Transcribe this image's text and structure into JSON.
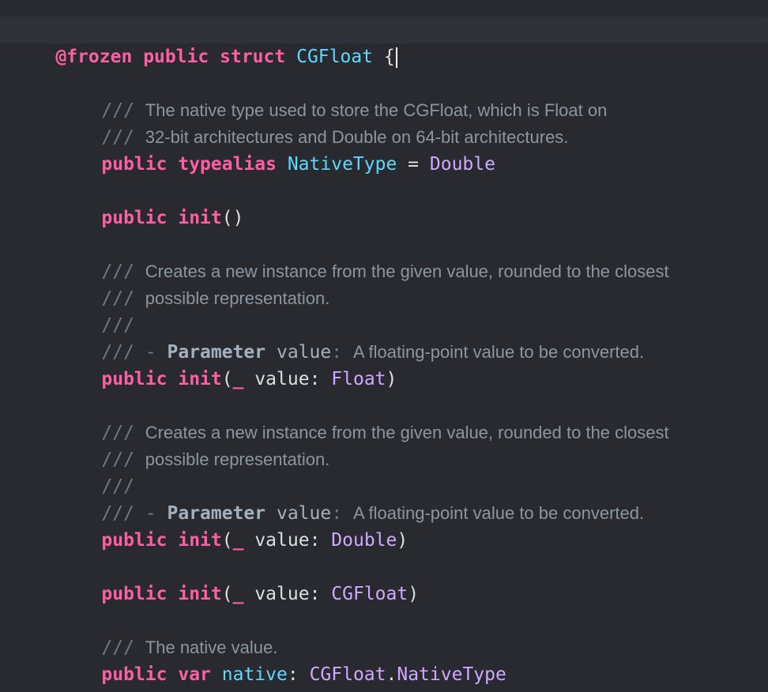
{
  "code": {
    "line1": {
      "attr": "@frozen",
      "kw1": "public",
      "kw2": "struct",
      "name": "CGFloat",
      "brace": "{"
    },
    "doc1a": {
      "slashes": "///",
      "text": "The native type used to store the CGFloat, which is Float on"
    },
    "doc1b": {
      "slashes": "///",
      "text": "32-bit architectures and Double on 64-bit architectures."
    },
    "typealias": {
      "kw1": "public",
      "kw2": "typealias",
      "name": "NativeType",
      "eq": "=",
      "type": "Double"
    },
    "init0": {
      "kw1": "public",
      "kw2": "init",
      "parens": "()"
    },
    "doc2a": {
      "slashes": "///",
      "text": "Creates a new instance from the given value, rounded to the closest"
    },
    "doc2b": {
      "slashes": "///",
      "text": "possible representation."
    },
    "doc2c": {
      "slashes": "///"
    },
    "doc2d": {
      "slashes": "/// -",
      "keyword": "Parameter",
      "param": "value",
      "colon": ":",
      "text": "A floating-point value to be converted."
    },
    "initFloat": {
      "kw1": "public",
      "kw2": "init",
      "open": "(",
      "underscore": "_",
      "label": "value",
      "colon": ":",
      "type": "Float",
      "close": ")"
    },
    "doc3a": {
      "slashes": "///",
      "text": "Creates a new instance from the given value, rounded to the closest"
    },
    "doc3b": {
      "slashes": "///",
      "text": "possible representation."
    },
    "doc3c": {
      "slashes": "///"
    },
    "doc3d": {
      "slashes": "/// -",
      "keyword": "Parameter",
      "param": "value",
      "colon": ":",
      "text": "A floating-point value to be converted."
    },
    "initDouble": {
      "kw1": "public",
      "kw2": "init",
      "open": "(",
      "underscore": "_",
      "label": "value",
      "colon": ":",
      "type": "Double",
      "close": ")"
    },
    "initCGFloat": {
      "kw1": "public",
      "kw2": "init",
      "open": "(",
      "underscore": "_",
      "label": "value",
      "colon": ":",
      "type": "CGFloat",
      "close": ")"
    },
    "doc4a": {
      "slashes": "///",
      "text": "The native value."
    },
    "native": {
      "kw1": "public",
      "kw2": "var",
      "name": "native",
      "colon": ":",
      "type1": "CGFloat",
      "dot": ".",
      "type2": "NativeType"
    },
    "closing": {
      "brace": "}"
    }
  },
  "colors": {
    "background": "#292a30",
    "current_line": "#2f3239",
    "keyword": "#fc5fa3",
    "declaration": "#5dd8ff",
    "type": "#d0a8ff",
    "comment": "#6c7986",
    "doc_text": "#8c96a0",
    "plain": "#dfdfe0"
  }
}
